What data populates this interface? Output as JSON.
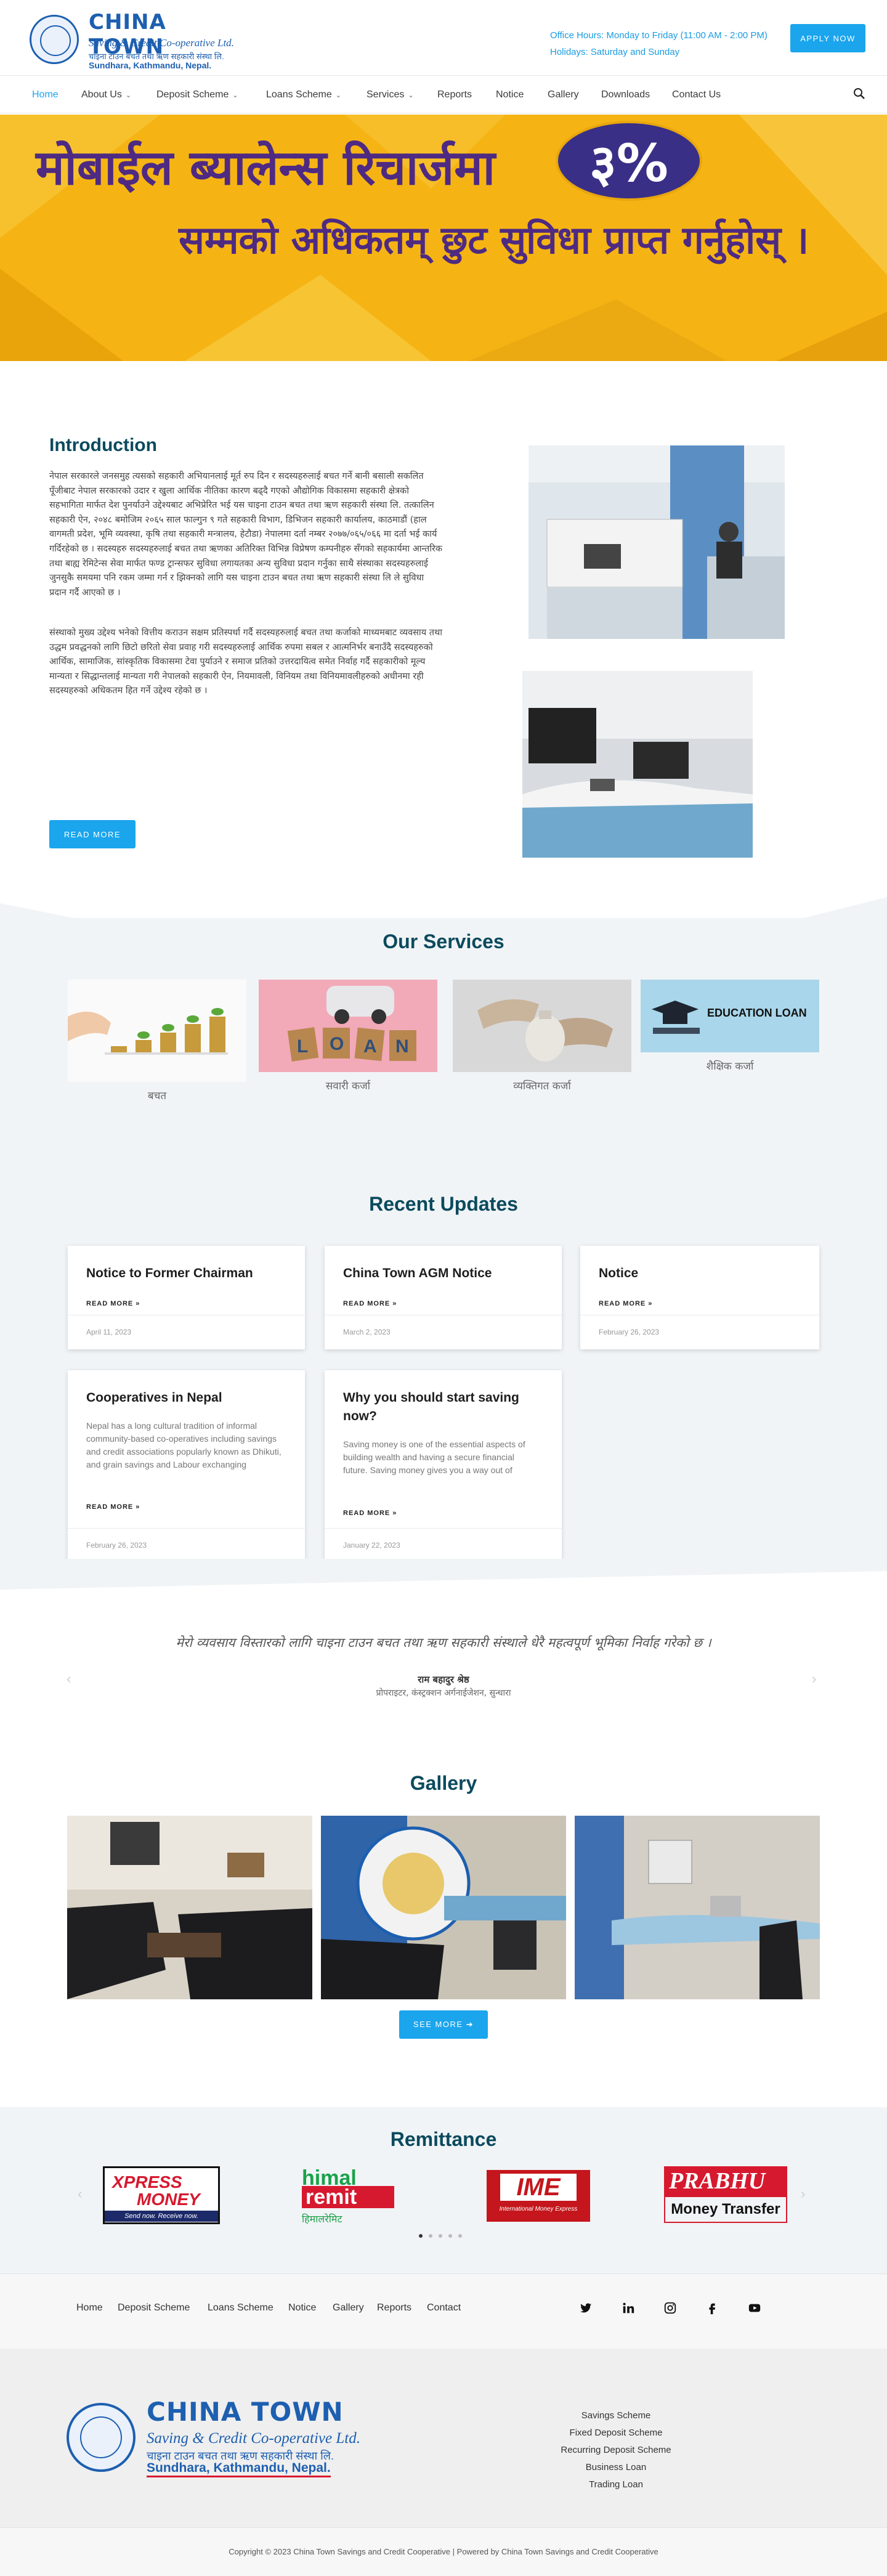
{
  "header": {
    "logo_title": "CHINA TOWN",
    "logo_subtitle": "Saving & Credit Co-operative Ltd.",
    "logo_nepali": "चाइना टाउन बचत तथा ऋण सहकारी संस्था लि.",
    "logo_address": "Sundhara, Kathmandu, Nepal.",
    "office_hours": "Office Hours: Monday to Friday (11:00 AM - 2:00 PM)",
    "holidays": "Holidays: Saturday and Sunday",
    "apply_label": "APPLY NOW"
  },
  "nav": {
    "items": [
      {
        "label": "Home"
      },
      {
        "label": "About Us"
      },
      {
        "label": "Deposit Scheme"
      },
      {
        "label": "Loans Scheme"
      },
      {
        "label": "Services"
      },
      {
        "label": "Reports"
      },
      {
        "label": "Notice"
      },
      {
        "label": "Gallery"
      },
      {
        "label": "Downloads"
      },
      {
        "label": "Contact Us"
      }
    ]
  },
  "banner": {
    "line1": "मोबाईल ब्यालेन्स रिचार्जमा",
    "percent": "३%",
    "line2": "सम्मको अधिकतम् छुट सुविधा प्राप्त गर्नुहोस् ।"
  },
  "intro": {
    "title": "Introduction",
    "para1": "नेपाल सरकारले जनसमुह त्यसको सहकारी अभियानलाई मूर्त रुप दिन र सदस्यहरुलाई बचत गर्ने बानी बसाली सकलित पूँजीबाट नेपाल सरकारको उदार र खुला आर्थिक नीतिका कारण बढ्दै गएको औद्योगिक विकासमा सहकारी क्षेत्रको सहभागिता मार्फत देश पुनर्याउने उद्देश्यबाट अभिप्रेरित भई यस चाइना टाउन बचत तथा ऋण सहकारी संस्था लि. तत्कालिन सहकारी ऐन, २०४८ बमोजिम २०६५ साल फाल्गुन ९ गते सहकारी विभाग, डिभिजन सहकारी कार्यालय, काठमाडौं (हाल वागमती प्रदेश, भूमि व्यवस्था, कृषि तथा सहकारी मन्त्रालय, हेटौडा) नेपालमा दर्ता नम्बर २०७७/०६५/०६६ मा दर्ता भई कार्य गर्दिरहेको छ । सदस्यहरु सदस्यहरुलाई बचत तथा ऋणका अतिरिक्त विभिन्न विप्रेषण कम्पनीहरु सँगको सहकार्यमा आन्तरिक तथा बाह्य रेमिटेन्स सेवा मार्फत फण्ड ट्रान्सफर सुविधा लगायतका अन्य सुविधा प्रदान गर्नुका साथै संस्थाका सदस्यहरुलाई जुनसुकै समयमा पनि रकम जम्मा गर्न र झिक्नको लागि यस चाइना टाउन बचत तथा ऋण सहकारी संस्था लि ले सुविधा प्रदान गर्दै आएको छ ।",
    "para2": "संस्थाको मुख्य उद्देश्य भनेको वित्तीय कराउन सक्षम प्रतिस्पर्धा गर्दै सदस्यहरुलाई बचत तथा कर्जाको माध्यमबाट व्यवसाय तथा उद्धम प्रवद्धनको लागि छिटो छरितो सेवा प्रवाह गरी सदस्यहरुलाई आर्थिक रुपमा सबल र आत्मनिर्भर बनाउँदै सदस्यहरुको आर्थिक, सामाजिक, सांस्कृतिक विकासमा टेवा पुर्याउने र समाज प्रतिको उत्तरदायित्व समेत निर्वाह गर्दै सहकारीको मूल्य मान्यता र सिद्धान्तलाई मान्यता गरी नेपालको सहकारी ऐन, नियमावली, विनियम तथा विनियमावलीहरुको अधीनमा रही सदस्यहरुको अधिकतम हित गर्ने उद्देश्य रहेको छ ।",
    "read_more": "READ MORE"
  },
  "services": {
    "title": "Our Services",
    "items": [
      {
        "label": "बचत"
      },
      {
        "label": "सवारी कर्जा"
      },
      {
        "label": "व्यक्तिगत कर्जा"
      },
      {
        "label": "शैक्षिक कर्जा",
        "image_text": "EDUCATION LOAN"
      }
    ],
    "loan_tiles": [
      "L",
      "O",
      "A",
      "N"
    ]
  },
  "updates": {
    "title": "Recent Updates",
    "read_more": "READ MORE »",
    "posts": [
      {
        "title": "Notice to Former Chairman",
        "date": "April 11, 2023"
      },
      {
        "title": "China Town AGM Notice",
        "date": "March 2, 2023"
      },
      {
        "title": "Notice",
        "date": "February 26, 2023"
      },
      {
        "title": "Cooperatives in Nepal",
        "excerpt": "Nepal has a long cultural tradition of informal community-based co-operatives including savings and credit associations popularly known as Dhikuti, and grain savings and Labour exchanging",
        "date": "February 26, 2023"
      },
      {
        "title": "Why you should start saving now?",
        "excerpt": "Saving money is one of the essential aspects of building wealth and having a secure financial future. Saving money gives you a way out of",
        "date": "January 22, 2023"
      }
    ]
  },
  "testimonial": {
    "quote": "मेरो व्यवसाय विस्तारको लागि चाइना टाउन बचत तथा ऋण सहकारी संस्थाले धेरै महत्वपूर्ण भूमिका निर्वाह गरेको छ ।",
    "name": "राम बहादुर श्रेष्ठ",
    "role": "प्रोपराइटर, कंस्ट्रक्शन अर्गनाईजेशन, सुन्धारा"
  },
  "gallery": {
    "title": "Gallery",
    "see_more": "SEE MORE ➔"
  },
  "remittance": {
    "title": "Remittance",
    "logos": [
      {
        "name": "Xpress Money",
        "line1": "XPRESS",
        "line2": "MONEY",
        "tag": "Send now. Receive now."
      },
      {
        "name": "Himal Remit",
        "line1": "himal",
        "line2": "remit",
        "tag": "हिमालरेमिट"
      },
      {
        "name": "IME",
        "line1": "IME",
        "tag": "International Money Express"
      },
      {
        "name": "Prabhu Money Transfer",
        "line1": "PRABHU",
        "line2": "Money Transfer"
      }
    ]
  },
  "footer_nav": {
    "links": [
      {
        "label": "Home"
      },
      {
        "label": "Deposit Scheme"
      },
      {
        "label": "Loans Scheme"
      },
      {
        "label": "Notice"
      },
      {
        "label": "Gallery"
      },
      {
        "label": "Reports"
      },
      {
        "label": "Contact"
      }
    ],
    "social": [
      "twitter-icon",
      "linkedin-icon",
      "instagram-icon",
      "facebook-icon",
      "youtube-icon"
    ]
  },
  "footer": {
    "links": [
      {
        "label": "Savings Scheme"
      },
      {
        "label": "Fixed Deposit Scheme"
      },
      {
        "label": "Recurring Deposit Scheme"
      },
      {
        "label": "Business Loan"
      },
      {
        "label": "Trading Loan"
      }
    ],
    "copyright": "Copyright © 2023 China Town Savings and Credit Cooperative | Powered by China Town Savings and Credit Cooperative"
  },
  "colors": {
    "accent": "#1aa5ed",
    "heading": "#0b4a5e",
    "banner_bg": "#f5b414",
    "banner_text": "#4e2a82"
  }
}
